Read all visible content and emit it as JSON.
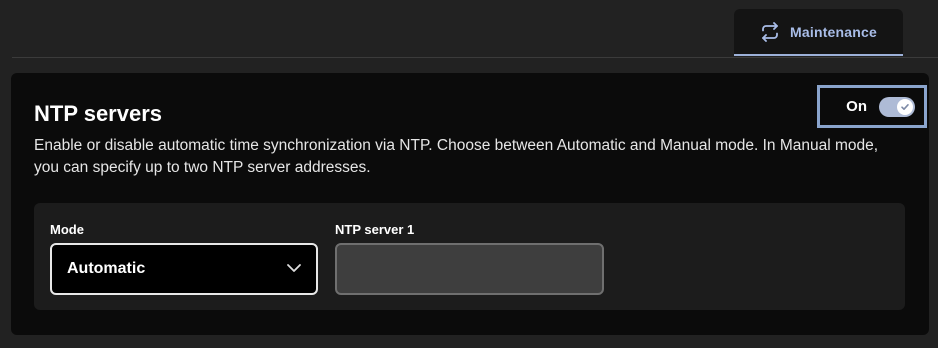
{
  "tabs": [
    {
      "label": "Maintenance",
      "icon": "sync-arrows-icon",
      "active": true
    }
  ],
  "card": {
    "title": "NTP servers",
    "description": "Enable or disable automatic time synchronization via NTP. Choose between Automatic and Manual mode. In Manual mode, you can specify up to two NTP server addresses.",
    "toggle": {
      "label": "On",
      "checked": true
    }
  },
  "form": {
    "mode": {
      "label": "Mode",
      "value": "Automatic"
    },
    "server1": {
      "label": "NTP server 1",
      "value": ""
    }
  },
  "colors": {
    "accent": "#a9bde8",
    "highlight": "#8aa4cd",
    "background": "#222222",
    "card": "#0b0b0b"
  }
}
